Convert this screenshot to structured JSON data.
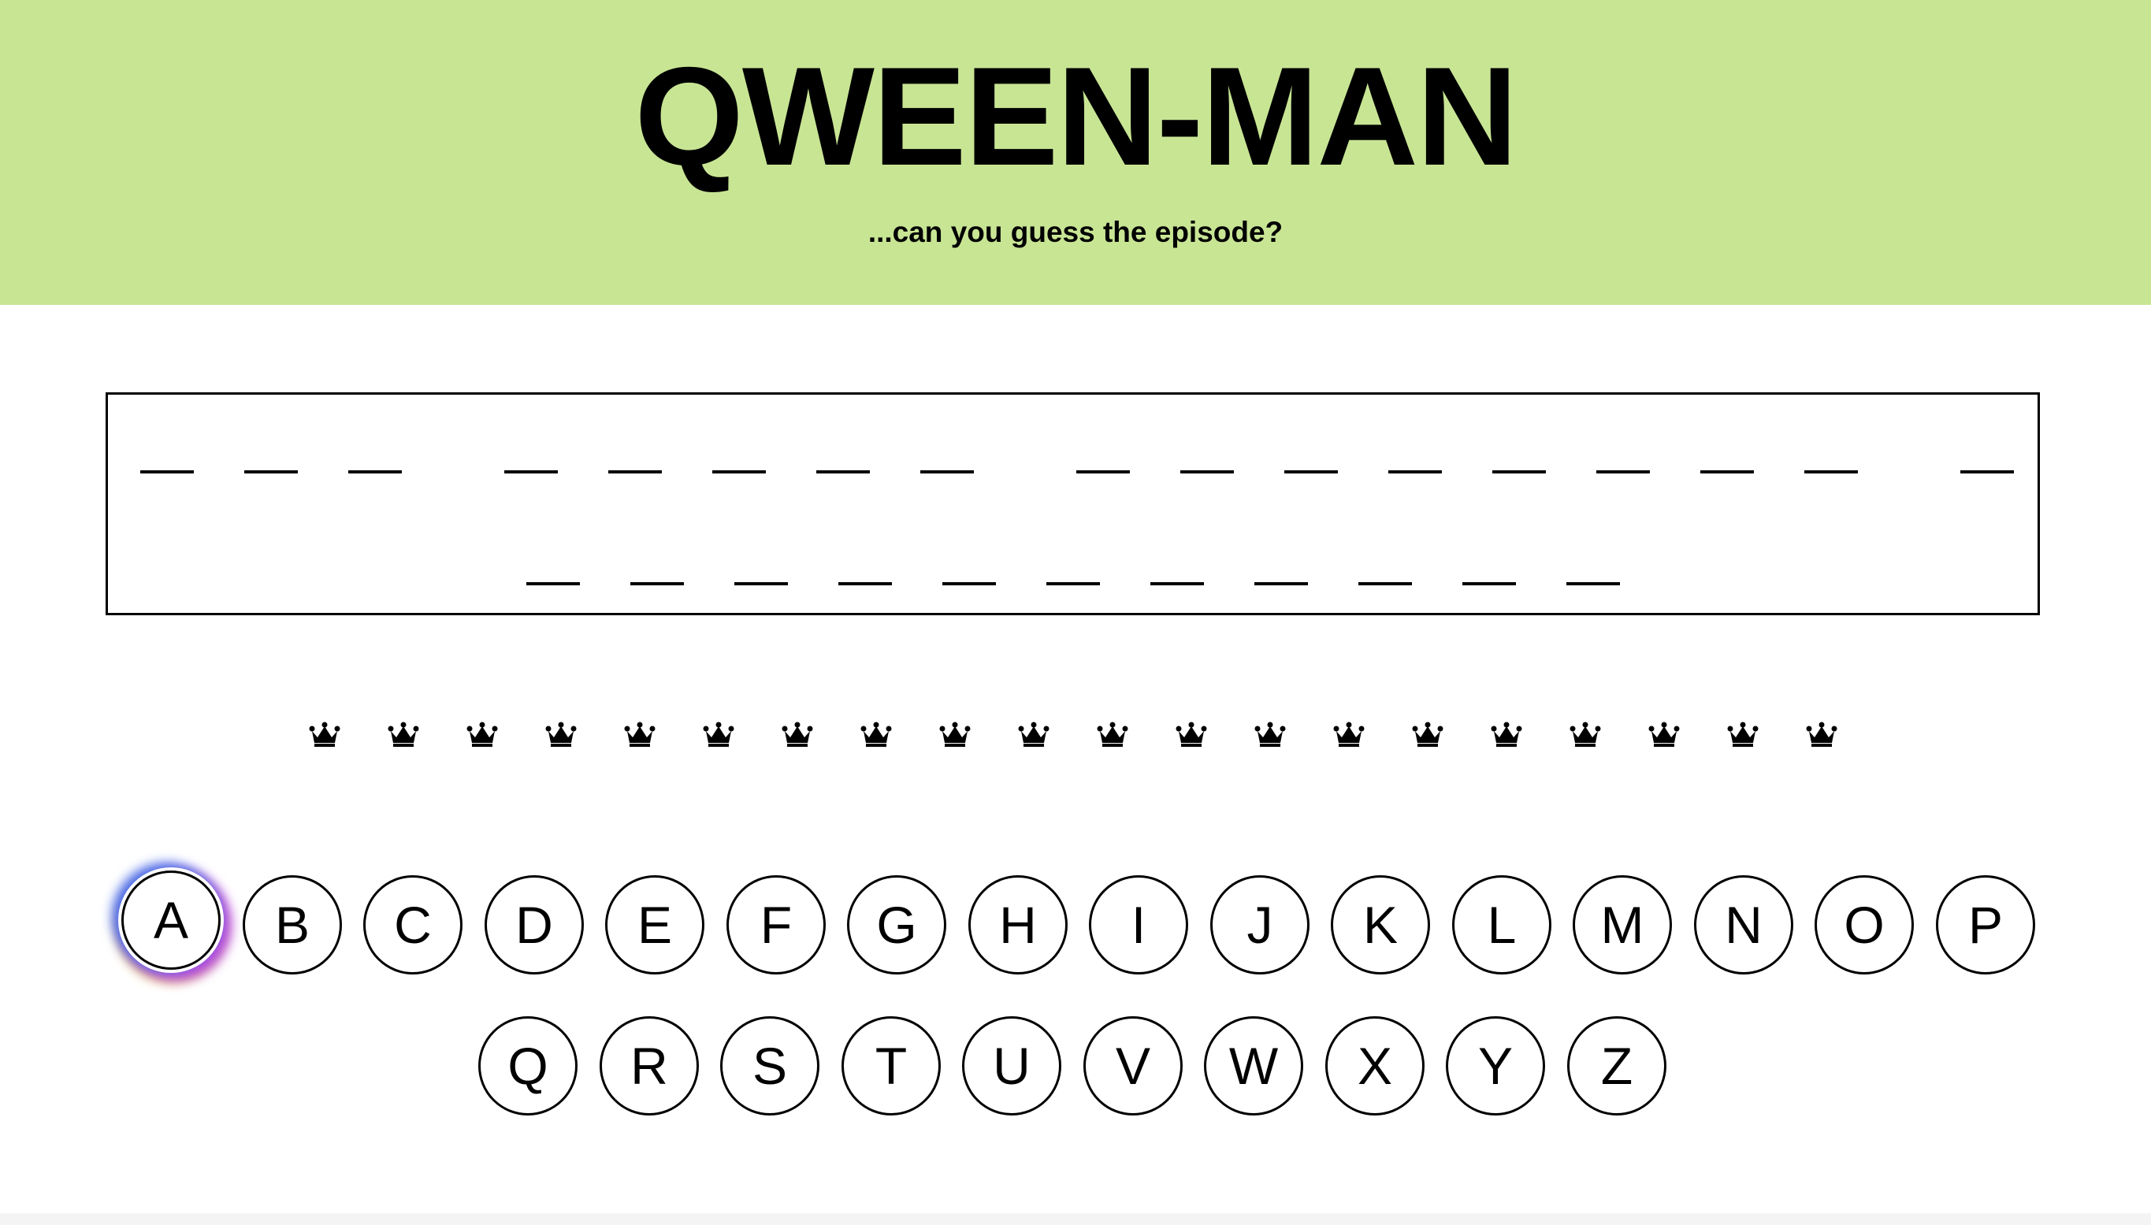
{
  "header": {
    "title": "QWEEN-MAN",
    "subtitle": "...can you guess the episode?",
    "background": "#c8e594"
  },
  "puzzle": {
    "rows": [
      {
        "words": [
          3,
          5,
          8,
          1
        ]
      },
      {
        "words": [
          11
        ]
      }
    ]
  },
  "lives": {
    "count": 20,
    "icon": "crown-icon"
  },
  "keyboard": {
    "focused": "A",
    "rows": [
      [
        "A",
        "B",
        "C",
        "D",
        "E",
        "F",
        "G",
        "H",
        "I",
        "J",
        "K",
        "L",
        "M",
        "N",
        "O",
        "P"
      ],
      [
        "Q",
        "R",
        "S",
        "T",
        "U",
        "V",
        "W",
        "X",
        "Y",
        "Z"
      ]
    ]
  }
}
